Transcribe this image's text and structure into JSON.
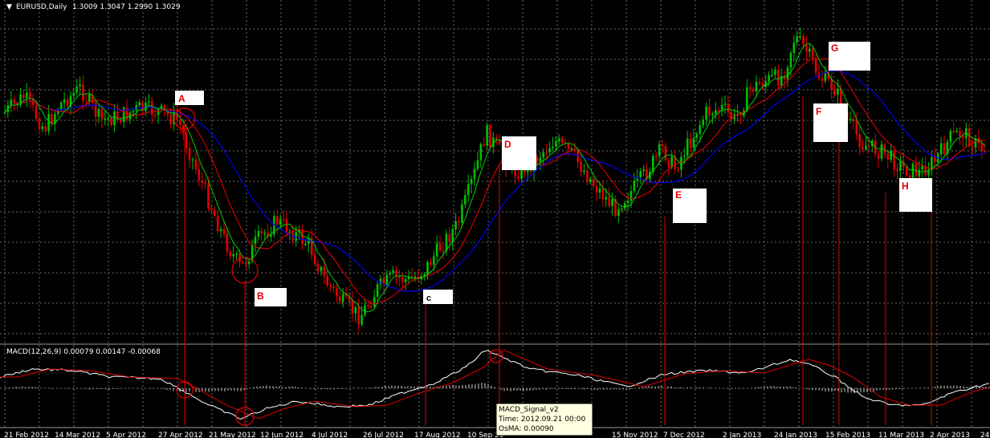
{
  "main_header": {
    "symbol": "EURUSD,Daily",
    "ohlc": "1.3009 1.3047 1.2990 1.3029"
  },
  "macd_header": {
    "text": "MACD(12,26,9) 0.00079 0.00147 -0.00068"
  },
  "tooltip": {
    "line1": "MACD_Signal_v2",
    "line2": "Time: 2012.09.21 00:00",
    "line3": "OsMA: 0.00090"
  },
  "colors": {
    "bg": "#000000",
    "grid": "#6a6a6a",
    "bull": "#00c000",
    "bear": "#e00000",
    "ma_fast": "#00d000",
    "ma_mid": "#e00000",
    "ma_slow": "#0000e0",
    "macd_main": "#ffffff",
    "macd_signal": "#e00000",
    "label_box": "#ffffff"
  },
  "chart_data": [
    {
      "type": "candlestick",
      "title": "EURUSD,Daily",
      "x_ticks": [
        "21 Feb 2012",
        "14 Mar 2012",
        "5 Apr 2012",
        "27 Apr 2012",
        "21 May 2012",
        "12 Jun 2012",
        "4 Jul 2012",
        "26 Jul 2012",
        "17 Aug 2012",
        "10 Sep 20",
        "15 Nov 2012",
        "7 Dec 2012",
        "2 Jan 2013",
        "24 Jan 2013",
        "15 Feb 2013",
        "11 Mar 2013",
        "2 Apr 2013",
        "24"
      ],
      "annotations": [
        "A",
        "B",
        "c",
        "D",
        "E",
        "F",
        "G",
        "H"
      ],
      "grid": true
    },
    {
      "type": "line",
      "title": "MACD(12,26,9) 0.00079 0.00147 -0.00068",
      "series": [
        {
          "name": "MACD",
          "values": [
            0.00079
          ]
        },
        {
          "name": "Signal",
          "values": [
            0.00147
          ]
        },
        {
          "name": "OsMA",
          "values": [
            -0.00068
          ]
        }
      ],
      "grid": true
    }
  ]
}
